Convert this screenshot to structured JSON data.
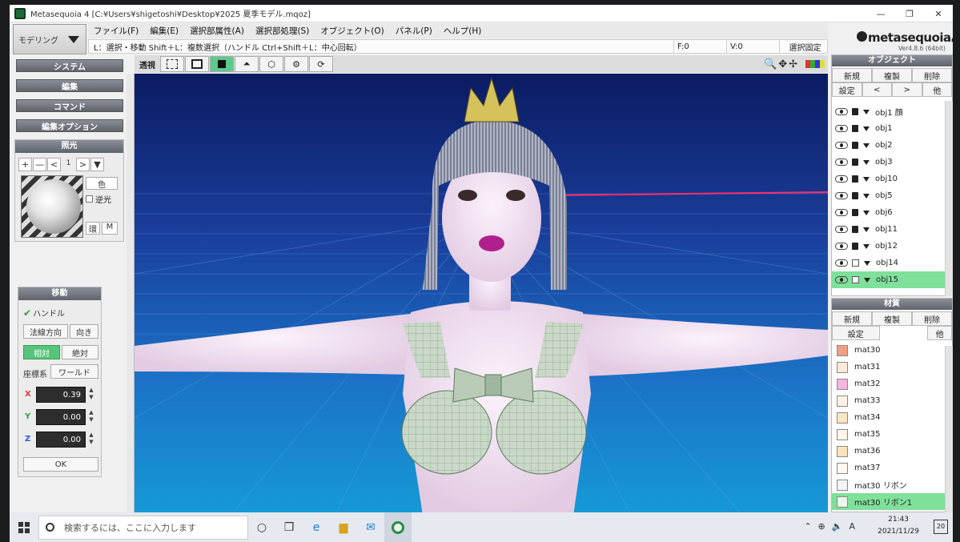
{
  "window": {
    "title": "Metasequoia 4 [C:¥Users¥shigetoshi¥Desktop¥2025  夏季モデル.mqoz]",
    "min_icon": "minimize-icon",
    "max_icon": "maximize-icon",
    "close_icon": "close-icon",
    "min": "—",
    "max": "❐",
    "close": "✕"
  },
  "mode": {
    "label": "モデリング"
  },
  "menu": [
    "ファイル(F)",
    "編集(E)",
    "選択部属性(A)",
    "選択部処理(S)",
    "オブジェクト(O)",
    "パネル(P)",
    "ヘルプ(H)"
  ],
  "status": {
    "message": "L：選択・移動  Shift＋L：複数選択（ハンドル  Ctrl+Shift＋L：中心回転）",
    "faces": "F:0",
    "vertices": "V:0",
    "lock_button": "選択固定"
  },
  "logo": {
    "name": "metasequoia",
    "num": "4",
    "version": "Ver4.8.6 (64bit)"
  },
  "left_buttons": [
    "システム",
    "編集",
    "コマンド",
    "編集オプション"
  ],
  "lighting": {
    "header": "照光",
    "plus": "+",
    "minus": "—",
    "prev": "<",
    "index": "1",
    "next": ">",
    "menu": "▼",
    "color": "色",
    "reverse": "逆光",
    "env": "環",
    "m": "M"
  },
  "move": {
    "header": "移動",
    "handle": "ハンドル",
    "normal": "法線方向",
    "direction": "向き",
    "relative": "相対",
    "absolute": "絶対",
    "coord_label": "座標系",
    "coord_value": "ワールド",
    "x_label": "X",
    "y_label": "Y",
    "z_label": "Z",
    "x": "0.39",
    "y": "0.00",
    "z": "0.00",
    "ok": "OK"
  },
  "toolbar": {
    "perspective": "透視"
  },
  "objects": {
    "header": "オブジェクト",
    "new": "新規",
    "duplicate": "複製",
    "delete": "削除",
    "settings": "設定",
    "prev": "<",
    "next": ">",
    "other": "他",
    "items": [
      {
        "name": "obj1 顔",
        "locked": true,
        "active": false
      },
      {
        "name": "obj1",
        "locked": true,
        "active": false
      },
      {
        "name": "obj2",
        "locked": true,
        "active": false
      },
      {
        "name": "obj3",
        "locked": true,
        "active": false
      },
      {
        "name": "obj10",
        "locked": true,
        "active": false
      },
      {
        "name": "obj5",
        "locked": true,
        "active": false
      },
      {
        "name": "obj6",
        "locked": true,
        "active": false
      },
      {
        "name": "obj11",
        "locked": true,
        "active": false
      },
      {
        "name": "obj12",
        "locked": true,
        "active": false
      },
      {
        "name": "obj14",
        "locked": false,
        "active": false
      },
      {
        "name": "obj15",
        "locked": false,
        "active": true
      }
    ]
  },
  "materials": {
    "header": "材質",
    "new": "新規",
    "duplicate": "複製",
    "delete": "削除",
    "settings": "設定",
    "other": "他",
    "items": [
      {
        "name": "mat30",
        "color": "#f0a080",
        "active": false
      },
      {
        "name": "mat31",
        "color": "#fde9dc",
        "active": false
      },
      {
        "name": "mat32",
        "color": "#f7b4df",
        "active": false
      },
      {
        "name": "mat33",
        "color": "#fdf1e6",
        "active": false
      },
      {
        "name": "mat34",
        "color": "#fbe6c3",
        "active": false
      },
      {
        "name": "mat35",
        "color": "#fff6e8",
        "active": false
      },
      {
        "name": "mat36",
        "color": "#fae3b8",
        "active": false
      },
      {
        "name": "mat37",
        "color": "#fff8ee",
        "active": false
      },
      {
        "name": "mat30 リボン",
        "color": "#f4f4f4",
        "active": false
      },
      {
        "name": "mat30 リボン1",
        "color": "#eaf7ea",
        "active": true
      }
    ]
  },
  "taskbar": {
    "search_placeholder": "検索するには、ここに入力します",
    "time": "21:43",
    "date": "2021/11/29",
    "ime": "A",
    "notifications": "20"
  },
  "colors": {
    "accent": "#5ec98a",
    "viewport_top": "#0b1b62",
    "viewport_bottom": "#169ad6"
  }
}
